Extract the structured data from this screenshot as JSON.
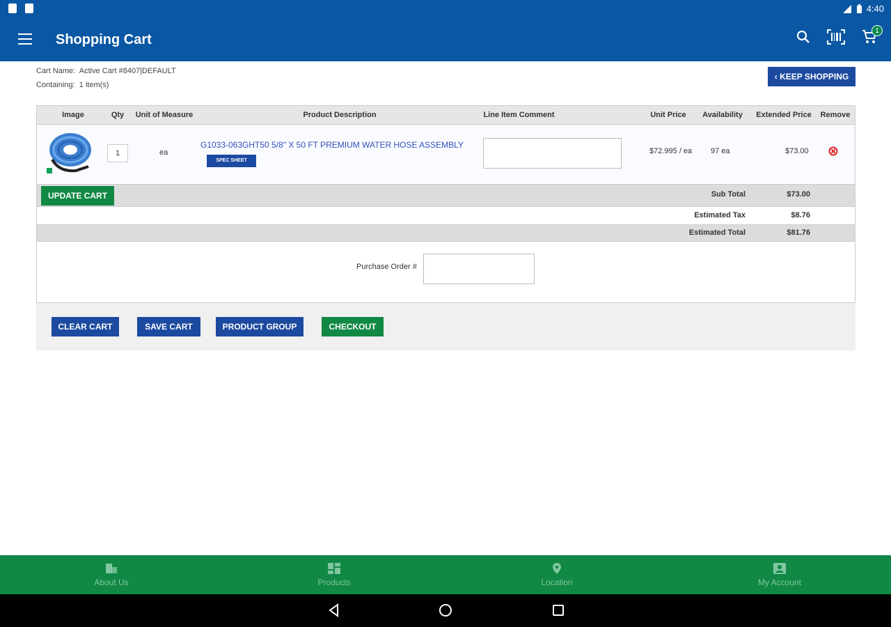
{
  "status": {
    "time": "4:40"
  },
  "appbar": {
    "title": "Shopping Cart",
    "cart_count": "1"
  },
  "meta": {
    "cart_name_label": "Cart Name:",
    "cart_name": "Active Cart #8407|DEFAULT",
    "containing_label": "Containing:",
    "containing": "1 item(s)"
  },
  "keep_shopping": "‹ KEEP SHOPPING",
  "table": {
    "headers": [
      "Image",
      "Qty",
      "Unit of Measure",
      "Product Description",
      "Line Item Comment",
      "Unit Price",
      "Availability",
      "Extended Price",
      "Remove"
    ],
    "row": {
      "qty": "1",
      "uom": "ea",
      "description": "G1033-063GHT50 5/8\" X 50 FT PREMIUM WATER HOSE ASSEMBLY",
      "spec_sheet": "SPEC SHEET",
      "unit_price": "$72.995 / ea",
      "availability": "97 ea",
      "extended_price": "$73.00"
    }
  },
  "totals": {
    "update_cart": "UPDATE CART",
    "sub_total_label": "Sub Total",
    "sub_total": "$73.00",
    "tax_label": "Estimated Tax",
    "tax": "$8.76",
    "total_label": "Estimated Total",
    "total": "$81.76"
  },
  "po": {
    "label": "Purchase Order #"
  },
  "actions": {
    "clear": "CLEAR CART",
    "save": "SAVE CART",
    "group": "PRODUCT GROUP",
    "checkout": "CHECKOUT"
  },
  "nav": [
    "About Us",
    "Products",
    "Location",
    "My Account"
  ],
  "colors": {
    "primary": "#0a57a4",
    "button_blue": "#1c4aa0",
    "green": "#118844"
  }
}
